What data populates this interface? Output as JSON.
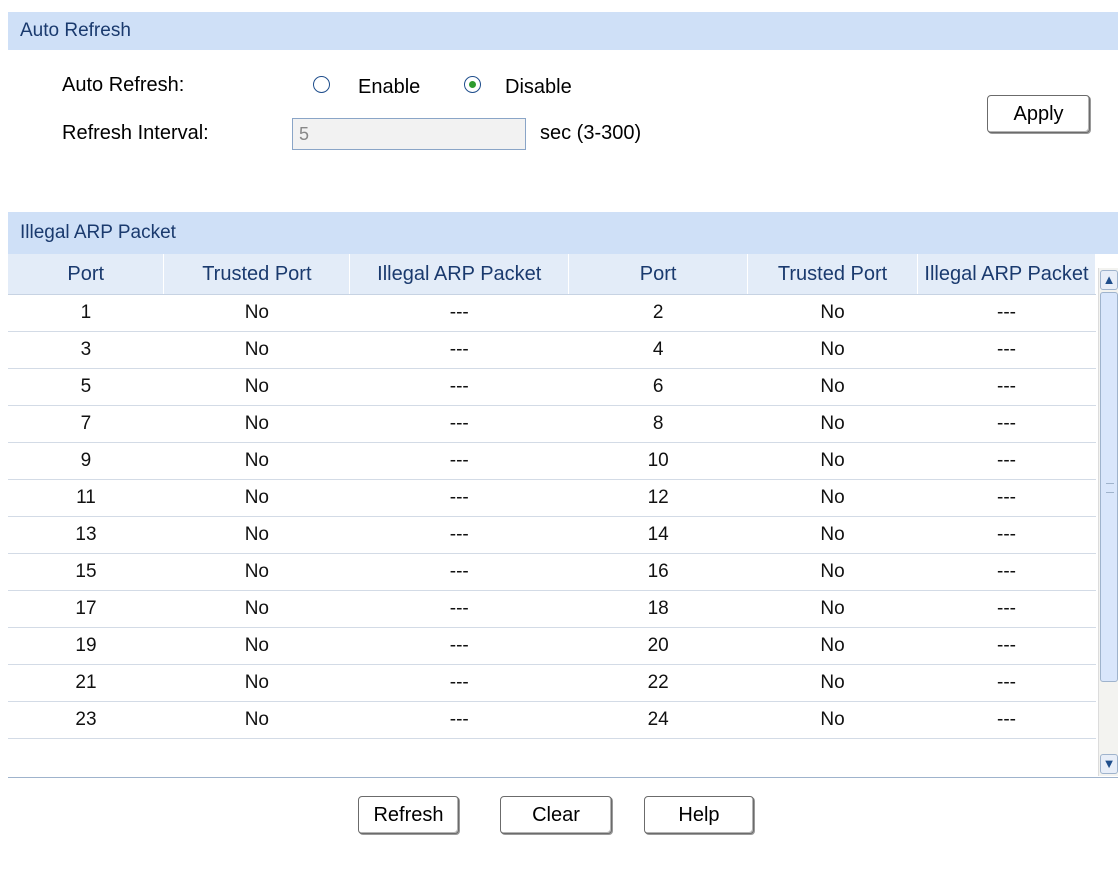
{
  "auto_refresh_section": {
    "title": "Auto Refresh",
    "auto_refresh_label": "Auto Refresh:",
    "enable_label": "Enable",
    "disable_label": "Disable",
    "selected": "Disable",
    "interval_label": "Refresh Interval:",
    "interval_value": "5",
    "interval_unit": "sec (3-300)",
    "apply_label": "Apply"
  },
  "illegal_arp_section": {
    "title": "Illegal ARP Packet",
    "columns": [
      "Port",
      "Trusted Port",
      "Illegal ARP Packet",
      "Port",
      "Trusted Port",
      "Illegal ARP Packet"
    ],
    "rows": [
      [
        "1",
        "No",
        "---",
        "2",
        "No",
        "---"
      ],
      [
        "3",
        "No",
        "---",
        "4",
        "No",
        "---"
      ],
      [
        "5",
        "No",
        "---",
        "6",
        "No",
        "---"
      ],
      [
        "7",
        "No",
        "---",
        "8",
        "No",
        "---"
      ],
      [
        "9",
        "No",
        "---",
        "10",
        "No",
        "---"
      ],
      [
        "11",
        "No",
        "---",
        "12",
        "No",
        "---"
      ],
      [
        "13",
        "No",
        "---",
        "14",
        "No",
        "---"
      ],
      [
        "15",
        "No",
        "---",
        "16",
        "No",
        "---"
      ],
      [
        "17",
        "No",
        "---",
        "18",
        "No",
        "---"
      ],
      [
        "19",
        "No",
        "---",
        "20",
        "No",
        "---"
      ],
      [
        "21",
        "No",
        "---",
        "22",
        "No",
        "---"
      ],
      [
        "23",
        "No",
        "---",
        "24",
        "No",
        "---"
      ]
    ]
  },
  "buttons": {
    "refresh_label": "Refresh",
    "clear_label": "Clear",
    "help_label": "Help"
  },
  "colors": {
    "section_header_bg": "#cfe0f7",
    "radio_checked": "#2e9b2e"
  }
}
